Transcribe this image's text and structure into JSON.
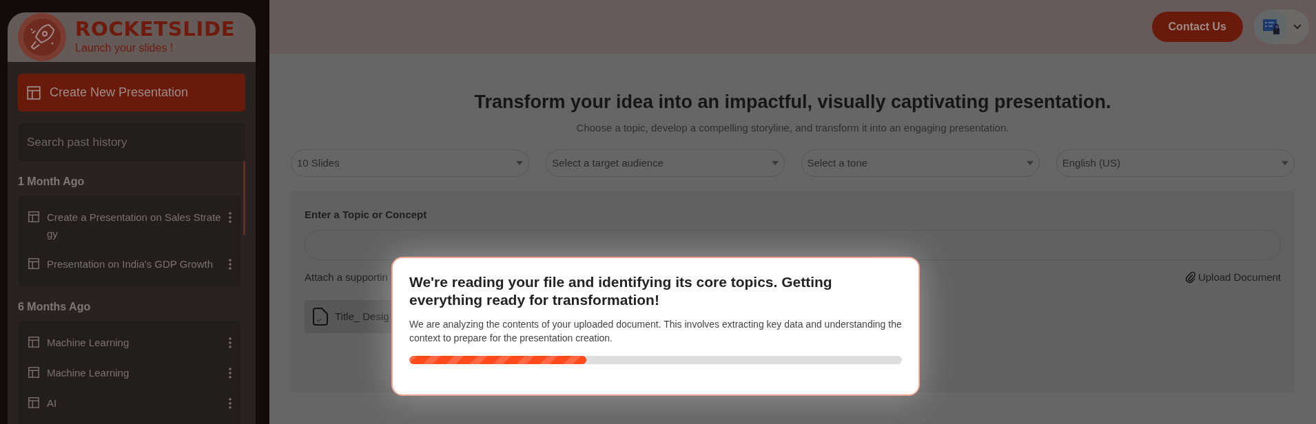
{
  "brand": {
    "name": "ROCKETSLIDE",
    "tagline": "Launch your slides !"
  },
  "sidebar": {
    "create_button": "Create New Presentation",
    "search": {
      "placeholder": "Search past history"
    },
    "groups": [
      {
        "label": "1 Month Ago",
        "items": [
          "Create a Presentation on Sales Strategy",
          "Presentation on India's GDP Growth"
        ]
      },
      {
        "label": "6 Months Ago",
        "items": [
          "Machine Learning",
          "Machine Learning",
          "AI"
        ]
      }
    ]
  },
  "header": {
    "contact_button": "Contact Us"
  },
  "main": {
    "title": "Transform your idea into an impactful, visually captivating presentation.",
    "subtitle": "Choose a topic, develop a compelling storyline, and transform it into an engaging presentation.",
    "selects": [
      {
        "value": "10 Slides"
      },
      {
        "value": "Select a target audience"
      },
      {
        "value": "Select a tone"
      },
      {
        "value": "English (US)"
      }
    ],
    "topic_label": "Enter a Topic or Concept",
    "attach_label": "Attach a supportin",
    "upload_link": "Upload Document",
    "document": {
      "name": "Title_ Desig"
    }
  },
  "modal": {
    "title": "We're reading your file and identifying its core topics. Getting everything ready for transformation!",
    "body": "We are analyzing the contents of your uploaded document. This involves extracting key data and understanding the context to prepare for the presentation creation.",
    "progress": {
      "level": 0.36
    }
  }
}
